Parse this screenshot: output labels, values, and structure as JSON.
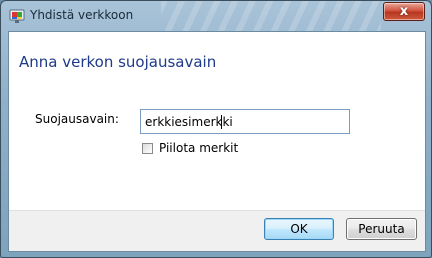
{
  "window": {
    "title": "Yhdistä verkkoon",
    "close_glyph": "x"
  },
  "content": {
    "heading": "Anna verkon suojausavain",
    "key_label": "Suojausavain:",
    "key_value": "erkkiesimerkki",
    "hide_characters_label": "Piilota merkit",
    "hide_characters_checked": false
  },
  "buttons": {
    "ok": "OK",
    "cancel": "Peruuta"
  },
  "icons": {
    "app": "network-connect-icon",
    "close": "close-icon"
  }
}
